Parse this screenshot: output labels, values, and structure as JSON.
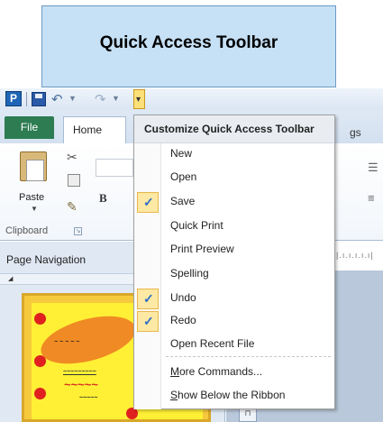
{
  "callout": {
    "title": "Quick Access Toolbar"
  },
  "app_icon_letter": "P",
  "ribbon": {
    "tabs": {
      "file": "File",
      "home": "Home",
      "partial_tab": "gs"
    },
    "clipboard": {
      "paste_label": "Paste",
      "group_label": "Clipboard"
    },
    "font": {
      "bold_label": "B"
    }
  },
  "nav_pane": {
    "title": "Page Navigation"
  },
  "menu": {
    "header": "Customize Quick Access Toolbar",
    "items": [
      {
        "label": "New",
        "checked": false
      },
      {
        "label": "Open",
        "checked": false
      },
      {
        "label": "Save",
        "checked": true
      },
      {
        "label": "Quick Print",
        "checked": false
      },
      {
        "label": "Print Preview",
        "checked": false
      },
      {
        "label": "Spelling",
        "checked": false
      },
      {
        "label": "Undo",
        "checked": true
      },
      {
        "label": "Redo",
        "checked": true
      },
      {
        "label": "Open Recent File",
        "checked": false
      }
    ],
    "more_commands": {
      "accel": "M",
      "rest": "ore Commands..."
    },
    "show_below": {
      "accel": "S",
      "rest": "how Below the Ribbon"
    }
  },
  "colors": {
    "callout_bg": "#c6e0f5",
    "file_tab": "#2d7c52",
    "check_highlight": "#fde8a4",
    "check_mark": "#2f6cc0"
  }
}
